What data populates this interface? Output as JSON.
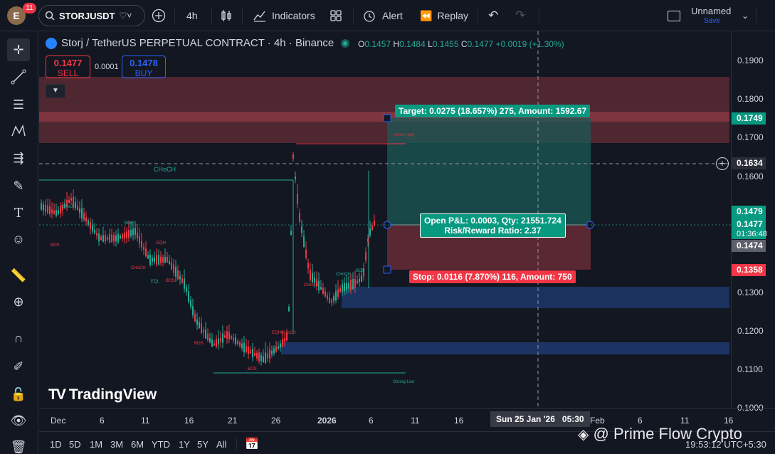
{
  "topbar": {
    "avatar_letter": "E",
    "notifications": "11",
    "symbol": "STORJUSDT",
    "interval": "4h",
    "indicators": "Indicators",
    "alert": "Alert",
    "replay": "Replay",
    "layout_name": "Unnamed",
    "layout_save": "Save"
  },
  "legend": {
    "title": "Storj / TetherUS PERPETUAL CONTRACT · 4h · Binance",
    "o_key": "O",
    "o": "0.1457",
    "h_key": "H",
    "h": "0.1484",
    "l_key": "L",
    "l": "0.1455",
    "c_key": "C",
    "c": "0.1477",
    "change": "+0.0019 (+1.30%)",
    "sell_price": "0.1477",
    "sell_label": "SELL",
    "spread": "0.0001",
    "buy_price": "0.1478",
    "buy_label": "BUY"
  },
  "price_axis": {
    "ticks": [
      "0.1900",
      "0.1800",
      "0.1700",
      "0.1600",
      "0.1300",
      "0.1200",
      "0.1100",
      "0.1000"
    ],
    "tag_target": "0.1749",
    "tag_crosshair": "0.1634",
    "tag_1479": "0.1479",
    "tag_last": "0.1477",
    "tag_countdown": "01:36:48",
    "tag_1474": "0.1474",
    "tag_stop": "0.1358"
  },
  "time_axis": {
    "ticks": [
      "Dec",
      "6",
      "11",
      "16",
      "21",
      "26",
      "2026",
      "6",
      "11",
      "16",
      "Feb",
      "6",
      "11",
      "16"
    ],
    "crosshair": "Sun 25 Jan '26   05:30"
  },
  "position": {
    "target": "Target: 0.0275 (18.657%) 275, Amount: 1592.67",
    "open_pl": "Open P&L: 0.0003, Qty: 21551.724",
    "rr": "Risk/Reward Ratio: 2.37",
    "stop": "Stop: 0.0116 (7.870%) 116, Amount: 750"
  },
  "annotations": {
    "choch_main": "CHoCH",
    "weak_high": "Weak High",
    "strong_low": "Strong Low",
    "bos": "BOS",
    "eqh": "EQH",
    "eql": "EQL",
    "choch": "CHoCH",
    "eqh_choch": "EQHCHoCH"
  },
  "bottombar": {
    "ranges": [
      "1D",
      "5D",
      "1M",
      "3M",
      "6M",
      "YTD",
      "1Y",
      "5Y",
      "All"
    ],
    "clock": "19:53:12 UTC+5:30"
  },
  "watermark": {
    "tv": "TradingView",
    "brand": "@ Prime Flow Crypto"
  },
  "colors": {
    "bg": "#131722",
    "up": "#22ab94",
    "down": "#f23645",
    "blue": "#2962ff"
  }
}
